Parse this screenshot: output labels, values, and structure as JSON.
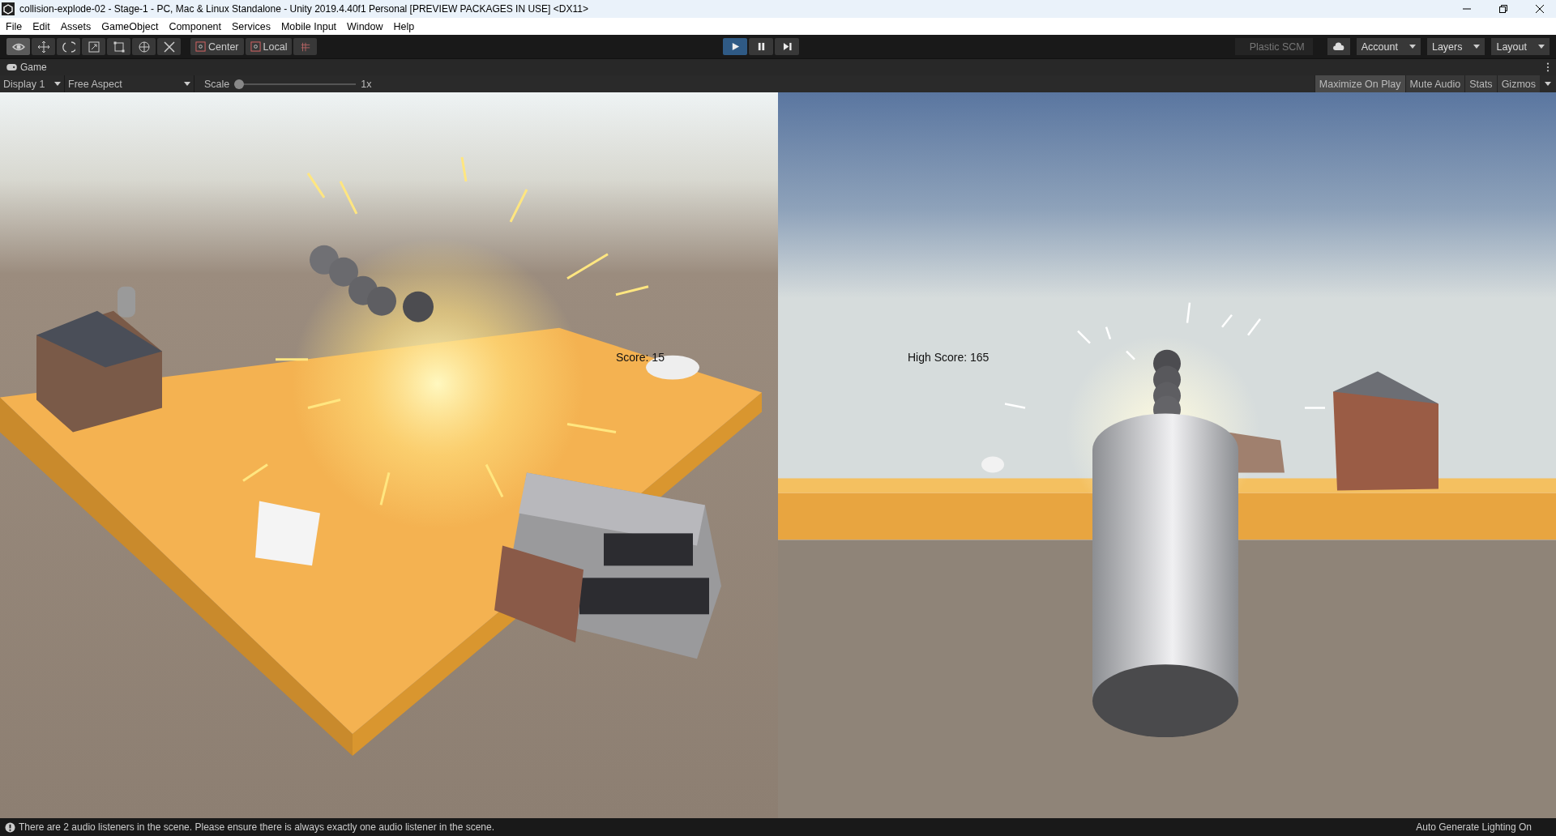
{
  "window": {
    "title": "collision-explode-02 - Stage-1 - PC, Mac & Linux Standalone - Unity 2019.4.40f1 Personal [PREVIEW PACKAGES IN USE] <DX11>"
  },
  "menu": [
    "File",
    "Edit",
    "Assets",
    "GameObject",
    "Component",
    "Services",
    "Mobile Input",
    "Window",
    "Help"
  ],
  "tools": [
    {
      "kind": "view",
      "selected": true
    },
    {
      "kind": "move",
      "selected": false
    },
    {
      "kind": "rotate",
      "selected": false
    },
    {
      "kind": "scale",
      "selected": false
    },
    {
      "kind": "rect",
      "selected": false
    },
    {
      "kind": "transform",
      "selected": false
    },
    {
      "kind": "custom",
      "selected": false
    }
  ],
  "pivot": [
    "Center",
    "Local"
  ],
  "playback": [
    {
      "kind": "play",
      "selected": true
    },
    {
      "kind": "pause",
      "selected": false
    },
    {
      "kind": "step",
      "selected": false
    }
  ],
  "collab": "Plastic SCM",
  "dropdowns": [
    "Account",
    "Layers",
    "Layout"
  ],
  "game_tab": "Game",
  "game_toolbar": {
    "display": "Display 1",
    "aspect": "Free Aspect",
    "scale_label": "Scale",
    "scale": {
      "level": 0
    },
    "scale_reading": "1x",
    "toggles": [
      {
        "label": "Maximize On Play",
        "selected": true
      },
      {
        "label": "Mute Audio",
        "selected": false
      },
      {
        "label": "Stats",
        "selected": false
      },
      {
        "label": "Gizmos",
        "selected": false
      }
    ]
  },
  "viewports": [
    {
      "kind": "overview",
      "score": "Score: 15"
    },
    {
      "kind": "cannon",
      "score": "High Score: 165"
    }
  ],
  "status_bar": {
    "message": "There are 2 audio listeners in the scene. Please ensure there is always exactly one audio listener in the scene.",
    "right": "Auto Generate Lighting On"
  }
}
